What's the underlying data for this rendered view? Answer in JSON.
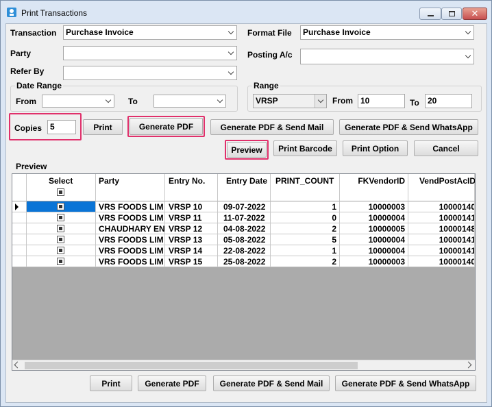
{
  "window": {
    "title": "Print Transactions"
  },
  "form": {
    "transaction_label": "Transaction",
    "transaction_value": "Purchase Invoice",
    "format_file_label": "Format File",
    "format_file_value": "Purchase Invoice",
    "party_label": "Party",
    "party_value": "",
    "posting_label": "Posting A/c",
    "posting_value": "",
    "refer_label": "Refer By",
    "refer_value": ""
  },
  "date_range": {
    "label": "Date Range",
    "from_label": "From",
    "to_label": "To",
    "from_value": "",
    "to_value": ""
  },
  "range": {
    "label": "Range",
    "series": "VRSP",
    "from_label": "From",
    "from_value": "10",
    "to_label": "To",
    "to_value": "20"
  },
  "copies": {
    "label": "Copies",
    "value": "5"
  },
  "buttons_top": {
    "print": "Print",
    "gen_pdf": "Generate PDF",
    "gen_pdf_mail": "Generate PDF & Send Mail",
    "gen_pdf_whatsapp": "Generate PDF & Send WhatsApp",
    "preview": "Preview",
    "print_barcode": "Print Barcode",
    "print_option": "Print Option",
    "cancel": "Cancel"
  },
  "preview": {
    "label": "Preview",
    "columns": [
      "Select",
      "Party",
      "Entry No.",
      "Entry Date",
      "PRINT_COUNT",
      "FKVendorID",
      "VendPostAcID"
    ],
    "rows": [
      {
        "party": "VRS FOODS LIM",
        "entry_no": "VRSP 10",
        "date": "09-07-2022",
        "count": "1",
        "vendor": "10000003",
        "postac": "10000140",
        "selected": true
      },
      {
        "party": "VRS FOODS LIM",
        "entry_no": "VRSP 11",
        "date": "11-07-2022",
        "count": "0",
        "vendor": "10000004",
        "postac": "10000141",
        "selected": true
      },
      {
        "party": "CHAUDHARY EN",
        "entry_no": "VRSP 12",
        "date": "04-08-2022",
        "count": "2",
        "vendor": "10000005",
        "postac": "10000148",
        "selected": true
      },
      {
        "party": "VRS FOODS LIM",
        "entry_no": "VRSP 13",
        "date": "05-08-2022",
        "count": "5",
        "vendor": "10000004",
        "postac": "10000141",
        "selected": true
      },
      {
        "party": "VRS FOODS LIM",
        "entry_no": "VRSP 14",
        "date": "22-08-2022",
        "count": "1",
        "vendor": "10000004",
        "postac": "10000141",
        "selected": true
      },
      {
        "party": "VRS FOODS LIM",
        "entry_no": "VRSP 15",
        "date": "25-08-2022",
        "count": "2",
        "vendor": "10000003",
        "postac": "10000140",
        "selected": true
      }
    ]
  },
  "buttons_bottom": {
    "print": "Print",
    "gen_pdf": "Generate PDF",
    "gen_pdf_mail": "Generate PDF & Send Mail",
    "gen_pdf_whatsapp": "Generate PDF & Send WhatsApp"
  },
  "colors": {
    "highlight": "#e0306b",
    "selection": "#0a74d6",
    "close": "#c75050"
  }
}
